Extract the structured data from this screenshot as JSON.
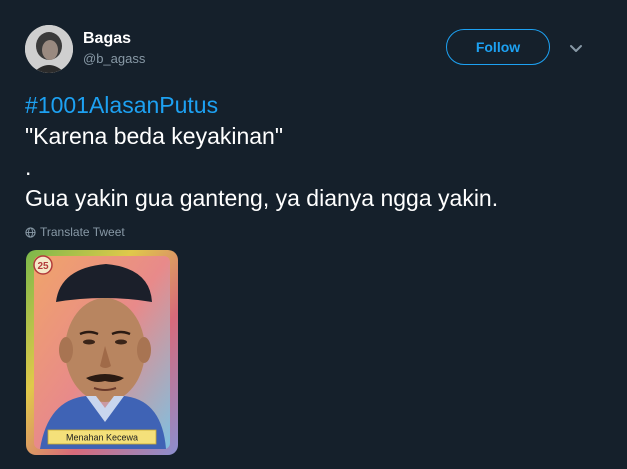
{
  "user": {
    "display_name": "Bagas",
    "handle": "@b_agass"
  },
  "actions": {
    "follow_label": "Follow"
  },
  "tweet": {
    "hashtag": "#1001AlasanPutus",
    "line2": "\"Karena beda keyakinan\"",
    "line3": ".",
    "line4": "Gua yakin gua ganteng, ya dianya ngga yakin."
  },
  "translate_label": "Translate Tweet",
  "media": {
    "card_number": "25",
    "caption": "Menahan Kecewa"
  },
  "colors": {
    "background": "#15202b",
    "accent": "#1da1f2",
    "secondary_text": "#8899a6"
  },
  "icons": [
    "chevron-down-icon",
    "globe-icon"
  ]
}
